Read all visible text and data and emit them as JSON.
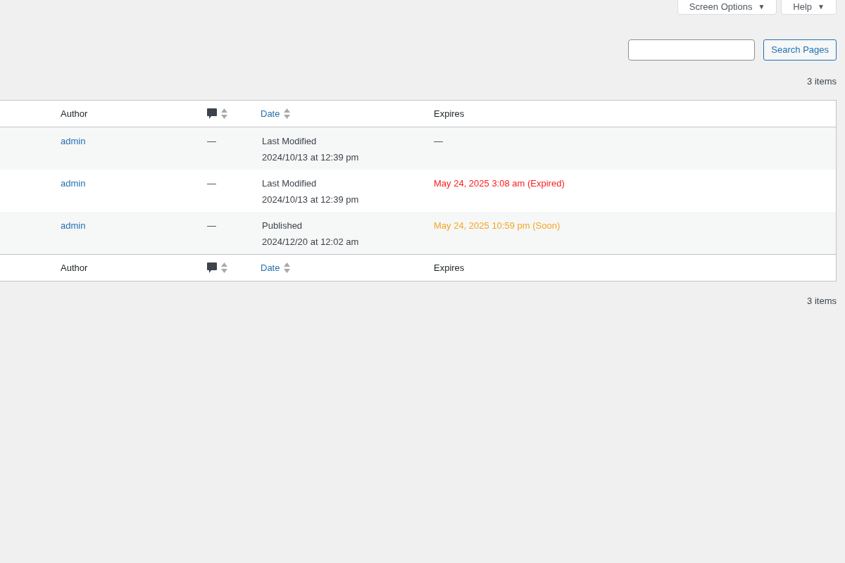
{
  "top_buttons": [
    {
      "label": "Screen Options",
      "caret": "▼"
    },
    {
      "label": "Help",
      "caret": "▼"
    }
  ],
  "search": {
    "button": "Search Pages"
  },
  "count_top": "3 items",
  "columns": [
    {
      "kind": "text",
      "label": "Author",
      "sortable": false
    },
    {
      "kind": "comments",
      "sortable": true
    },
    {
      "kind": "link",
      "label": "Date",
      "sortable": true
    },
    {
      "kind": "text",
      "label": "Expires",
      "sortable": false
    }
  ],
  "rows": [
    {
      "author": "admin",
      "comments": "—",
      "date_status": "Last Modified",
      "date": "2024/10/13 at 12:39 pm",
      "expires": "—"
    },
    {
      "author": "admin",
      "comments": "—",
      "date_status": "Last Modified",
      "date": "2024/10/13 at 12:39 pm",
      "expires": "May 24, 2025 3:08 am (Expired)",
      "color": "#ff1a1a"
    },
    {
      "author": "admin",
      "comments": "—",
      "date_status": "Published",
      "date": "2024/12/20 at 12:02 am",
      "expires": "May 24, 2025 10:59 pm (Soon)",
      "color": "#f5a623"
    }
  ],
  "footer_columns": [
    {
      "kind": "text",
      "label": "Author",
      "sortable": false
    },
    {
      "kind": "comments",
      "sortable": true
    },
    {
      "kind": "link",
      "label": "Date",
      "sortable": true
    },
    {
      "kind": "text",
      "label": "Expires",
      "sortable": false
    }
  ],
  "count_bottom": "3 items"
}
